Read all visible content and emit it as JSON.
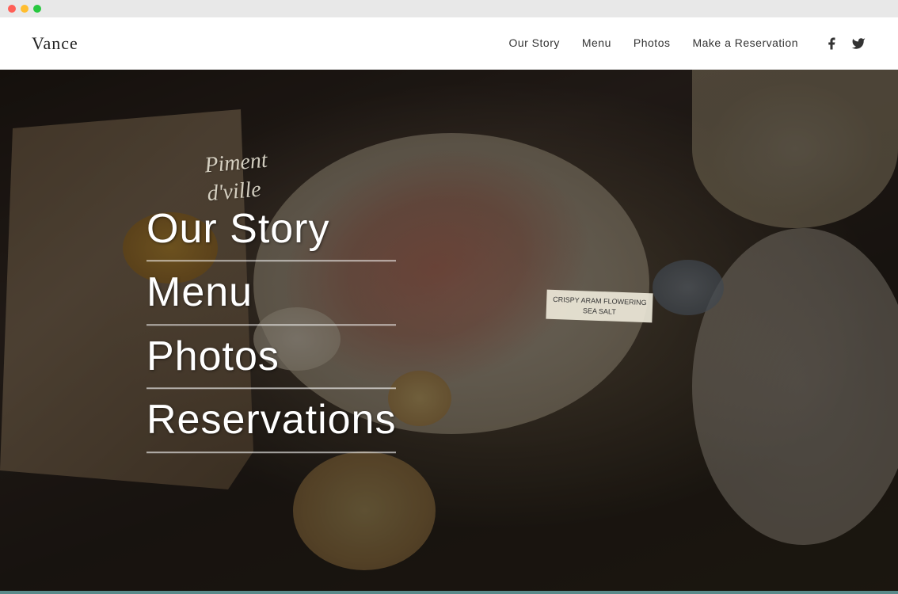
{
  "browser": {
    "dots": [
      "red",
      "yellow",
      "green"
    ]
  },
  "navbar": {
    "logo": "Vance",
    "links": [
      {
        "label": "Our Story",
        "href": "#"
      },
      {
        "label": "Menu",
        "href": "#"
      },
      {
        "label": "Photos",
        "href": "#"
      },
      {
        "label": "Make a Reservation",
        "href": "#"
      }
    ],
    "social": [
      {
        "name": "facebook",
        "icon": "f"
      },
      {
        "name": "twitter",
        "icon": "t"
      }
    ]
  },
  "hero": {
    "nav_items": [
      {
        "label": "Our Story",
        "href": "#"
      },
      {
        "label": "Menu",
        "href": "#"
      },
      {
        "label": "Photos",
        "href": "#"
      },
      {
        "label": "Reservations",
        "href": "#"
      }
    ],
    "handwriting_line1": "Piment",
    "handwriting_line2": "d'ville",
    "label_card_line1": "CRISPY ARAM FLOWERING",
    "label_card_line2": "SEA SALT"
  },
  "colors": {
    "accent_teal": "#5a8a8a",
    "navbar_bg": "#ffffff",
    "logo_color": "#222222",
    "nav_link_color": "#333333",
    "hero_text_color": "#ffffff"
  }
}
